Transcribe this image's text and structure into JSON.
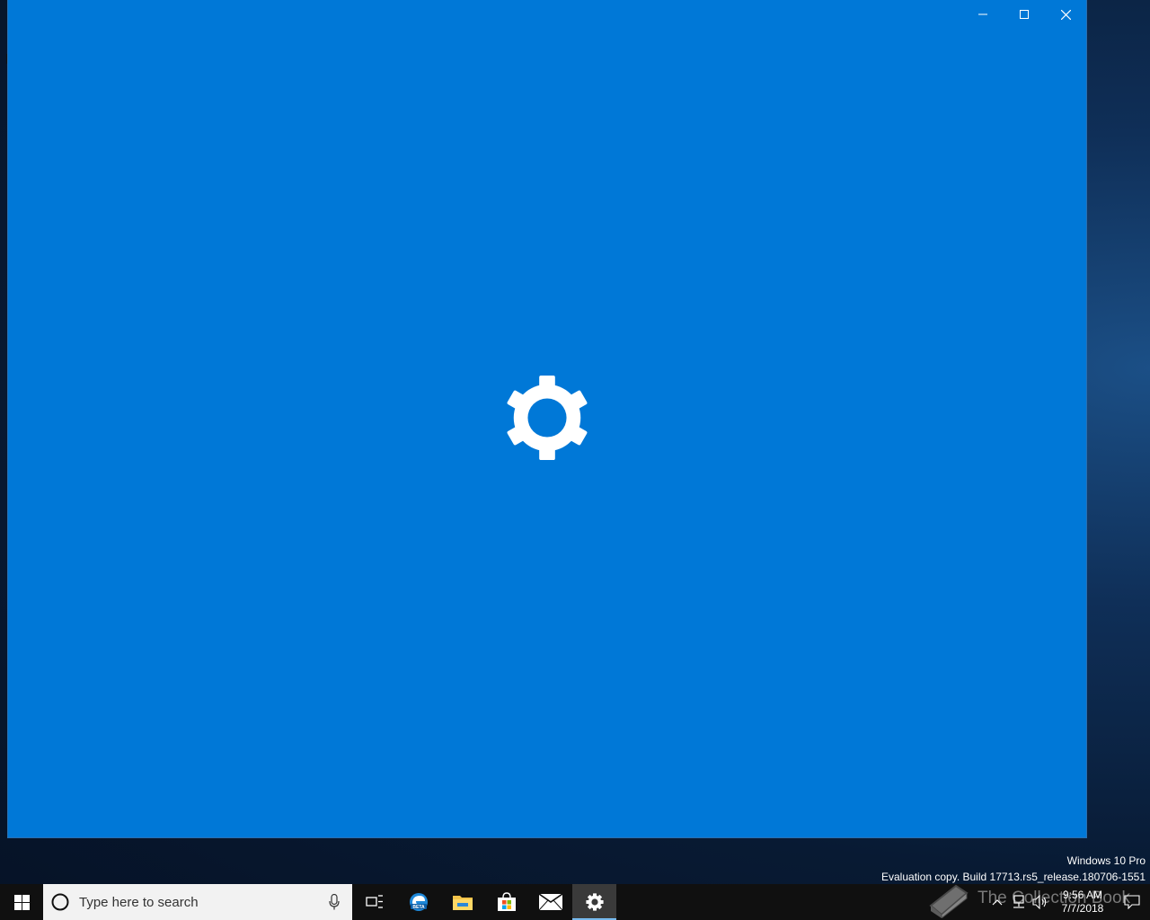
{
  "window": {
    "background": "#0078d7",
    "controls": [
      {
        "icon": "minimize-icon"
      },
      {
        "icon": "maximize-icon"
      },
      {
        "icon": "close-icon"
      }
    ],
    "splash_icon": "gear-icon"
  },
  "watermark": {
    "line1": "Windows 10 Pro",
    "line2": "Evaluation copy. Build 17713.rs5_release.180706-1551"
  },
  "taskbar": {
    "search_placeholder": "Type here to search",
    "apps": [
      {
        "icon": "task-view-icon"
      },
      {
        "icon": "edge-beta-icon"
      },
      {
        "icon": "file-explorer-icon"
      },
      {
        "icon": "store-icon"
      },
      {
        "icon": "mail-icon"
      },
      {
        "icon": "settings-gear-icon",
        "active": true
      }
    ]
  },
  "tray": {
    "time": "9:56 AM",
    "date": "7/7/2018",
    "icons": [
      "chevron-up-icon",
      "network-icon",
      "volume-icon",
      "notification-icon"
    ]
  },
  "brand_overlay": {
    "text": "The Collection Book",
    "icon": "book-icon"
  }
}
